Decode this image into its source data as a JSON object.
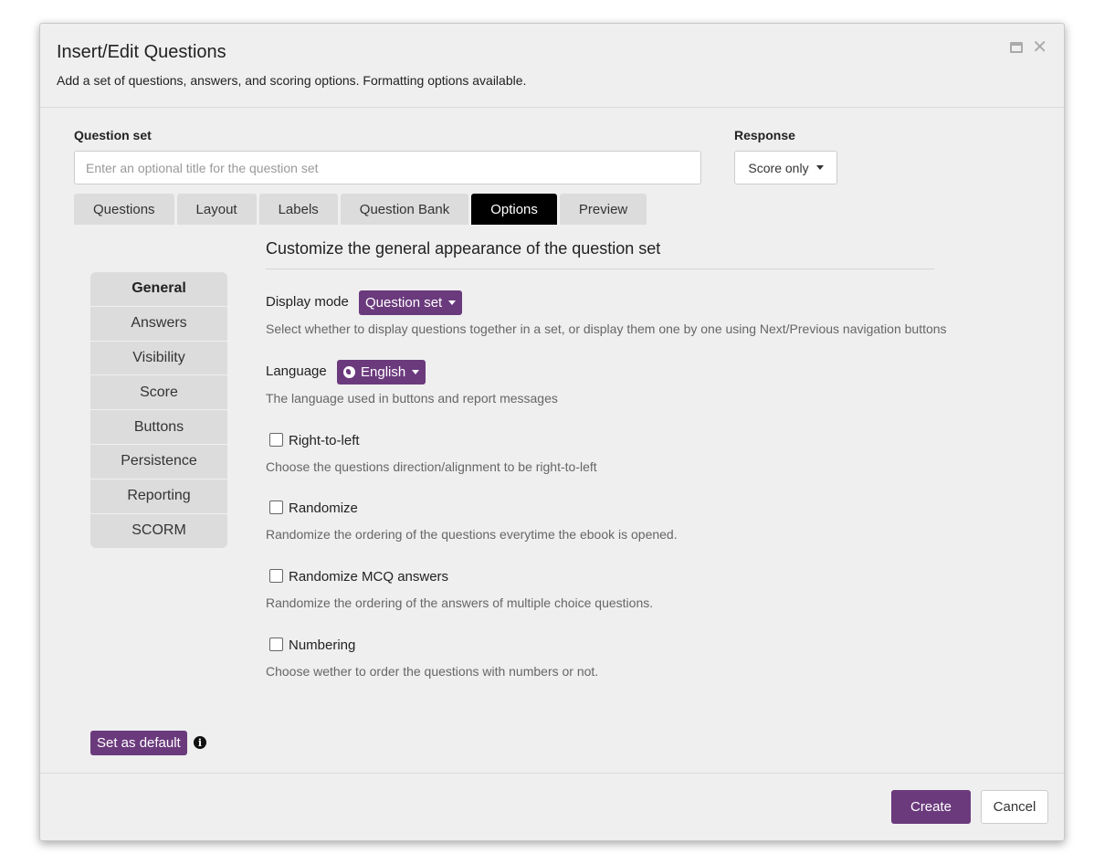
{
  "dialog": {
    "title": "Insert/Edit Questions",
    "subtitle": "Add a set of questions, answers, and scoring options. Formatting options available."
  },
  "question_set": {
    "label": "Question set",
    "placeholder": "Enter an optional title for the question set",
    "value": ""
  },
  "response": {
    "label": "Response",
    "selected": "Score only"
  },
  "tabs": [
    {
      "label": "Questions",
      "active": false
    },
    {
      "label": "Layout",
      "active": false
    },
    {
      "label": "Labels",
      "active": false
    },
    {
      "label": "Question Bank",
      "active": false
    },
    {
      "label": "Options",
      "active": true
    },
    {
      "label": "Preview",
      "active": false
    }
  ],
  "side_nav": [
    {
      "label": "General",
      "active": true
    },
    {
      "label": "Answers",
      "active": false
    },
    {
      "label": "Visibility",
      "active": false
    },
    {
      "label": "Score",
      "active": false
    },
    {
      "label": "Buttons",
      "active": false
    },
    {
      "label": "Persistence",
      "active": false
    },
    {
      "label": "Reporting",
      "active": false
    },
    {
      "label": "SCORM",
      "active": false
    }
  ],
  "options": {
    "section_title": "Customize the general appearance of the question set",
    "display_mode": {
      "label": "Display mode",
      "selected": "Question set",
      "help": "Select whether to display questions together in a set, or display them one by one using Next/Previous navigation buttons"
    },
    "language": {
      "label": "Language",
      "selected": "English",
      "icon": "globe-icon",
      "help": "The language used in buttons and report messages"
    },
    "right_to_left": {
      "label": "Right-to-left",
      "checked": false,
      "help": "Choose the questions direction/alignment to be right-to-left"
    },
    "randomize": {
      "label": "Randomize",
      "checked": false,
      "help": "Randomize the ordering of the questions everytime the ebook is opened."
    },
    "randomize_mcq": {
      "label": "Randomize MCQ answers",
      "checked": false,
      "help": "Randomize the ordering of the answers of multiple choice questions."
    },
    "numbering": {
      "label": "Numbering",
      "checked": false,
      "help": "Choose wether to order the questions with numbers or not."
    }
  },
  "set_default": {
    "label": "Set as default",
    "info_icon": "i"
  },
  "footer": {
    "create_label": "Create",
    "cancel_label": "Cancel"
  },
  "colors": {
    "accent": "#6b3a7d",
    "active_tab": "#000000",
    "dialog_bg": "#efefef"
  }
}
